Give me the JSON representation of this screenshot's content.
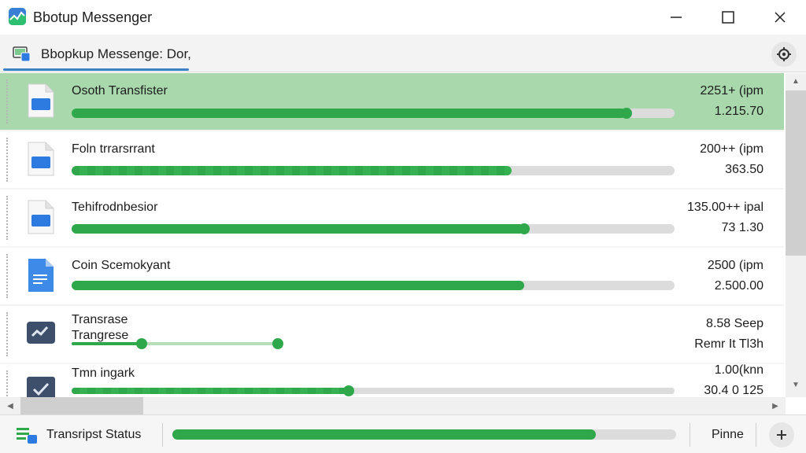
{
  "window": {
    "title": "Bbotup Messenger",
    "app_icon": "messenger-chart-icon",
    "controls": [
      "minimize-icon",
      "maximize-icon",
      "close-icon"
    ]
  },
  "toolbar": {
    "tab_label": "Bbopkup Messenge: Dor,",
    "tab_icon": "monitor-tab-icon",
    "settings_icon": "settings-icon"
  },
  "transfers": [
    {
      "name": "Osoth Transfister",
      "name2": "",
      "value1": "2251+ (ipm",
      "value2": "1.215.70",
      "progress": 0.92,
      "icon": "file-image-icon",
      "selected": true
    },
    {
      "name": "Foln trrarsrrant",
      "name2": "",
      "value1": "200++ (ipm",
      "value2": "363.50",
      "progress": 0.73,
      "icon": "file-image-icon",
      "selected": false
    },
    {
      "name": "Tehifrodnbesior",
      "name2": "",
      "value1": "135.00++ ipal",
      "value2": "73 1.30",
      "progress": 0.75,
      "icon": "file-image-icon",
      "selected": false
    },
    {
      "name": "Coin Scemokyant",
      "name2": "",
      "value1": "2500 (ipm",
      "value2": "2.500.00",
      "progress": 0.75,
      "icon": "file-doc-icon",
      "selected": false
    },
    {
      "name": "Transrase",
      "name2": "Trangrese",
      "value1": "8.58 Seep",
      "value2": "Remr It Tl3h",
      "progress": 0.34,
      "icon": "trend-folder-icon",
      "selected": false
    },
    {
      "name": "Tmn ingark",
      "name2": "",
      "value1": "1.00(knn",
      "value2": "30.4 0 125",
      "progress": 0.46,
      "icon": "check-folder-icon",
      "selected": false
    }
  ],
  "status": {
    "label": "Transripst Status",
    "icon": "transfer-status-icon",
    "progress": 0.84,
    "right_label": "Pinne",
    "add_icon": "add-icon"
  },
  "colors": {
    "accent_green": "#2ea84a",
    "selected_row": "#a8d8ac",
    "tab_underline": "#3b82c4",
    "file_blue": "#2d7be0"
  }
}
